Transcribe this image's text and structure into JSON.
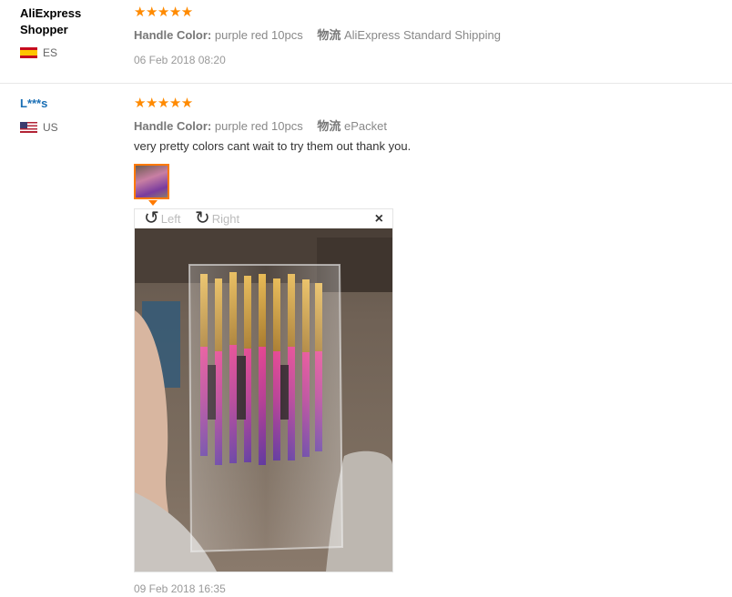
{
  "reviews": [
    {
      "user": "AliExpress Shopper",
      "country": "ES",
      "stars": "★★★★★",
      "handle_label": "Handle Color:",
      "handle_value": "purple red 10pcs",
      "shipping_label": "物流",
      "shipping_value": "AliExpress Standard Shipping",
      "date": "06 Feb 2018 08:20"
    },
    {
      "user": "L***s",
      "country": "US",
      "stars": "★★★★★",
      "handle_label": "Handle Color:",
      "handle_value": "purple red 10pcs",
      "shipping_label": "物流",
      "shipping_value": "ePacket",
      "feedback": "very pretty colors cant wait to try them out thank you.",
      "date": "09 Feb 2018 16:35"
    }
  ],
  "viewer": {
    "rotate_left": "Left",
    "rotate_right": "Right",
    "close": "×"
  },
  "colors": {
    "star": "#ff8a00",
    "link": "#1a6fb5",
    "thumb_border": "#ff7a00"
  }
}
